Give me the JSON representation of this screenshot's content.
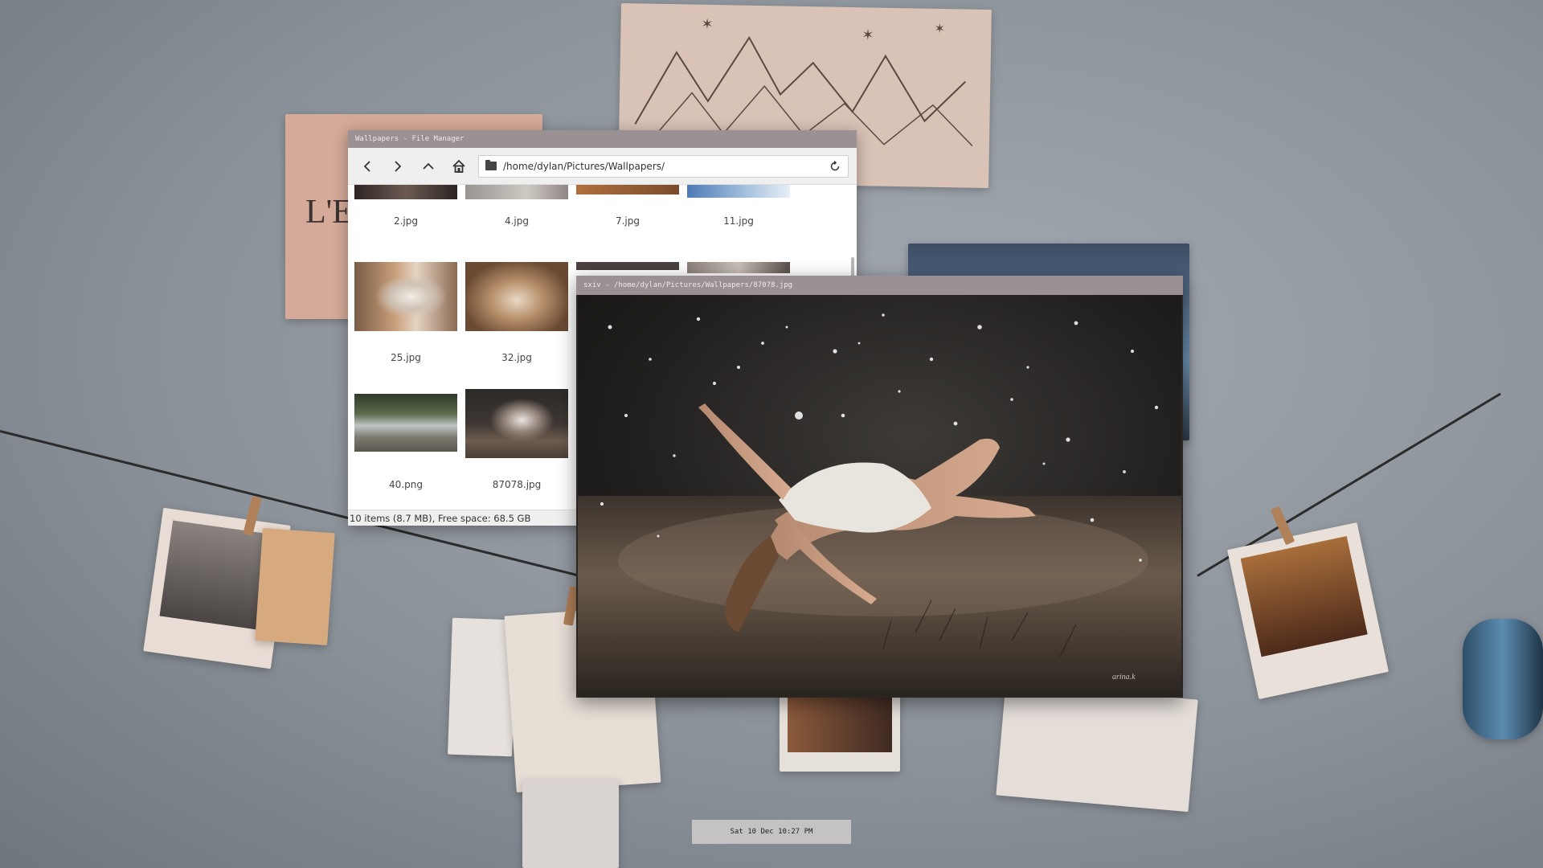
{
  "file_manager": {
    "title": "Wallpapers - File Manager",
    "path": "/home/dylan/Pictures/Wallpapers/",
    "status": "10 items (8.7 MB), Free space: 68.5 GB",
    "files": [
      {
        "name": "2.jpg"
      },
      {
        "name": "4.jpg"
      },
      {
        "name": "7.jpg"
      },
      {
        "name": "11.jpg"
      },
      {
        "name": "25.jpg"
      },
      {
        "name": "32.jpg"
      },
      {
        "name": "40.png"
      },
      {
        "name": "87078.jpg"
      }
    ]
  },
  "viewer": {
    "title": "sxiv - /home/dylan/Pictures/Wallpapers/87078.jpg"
  },
  "clock": {
    "text": "Sat 10 Dec 10:27 PM"
  },
  "colors": {
    "titlebar": "#9b9094",
    "clockbar": "#c5c2c3"
  }
}
